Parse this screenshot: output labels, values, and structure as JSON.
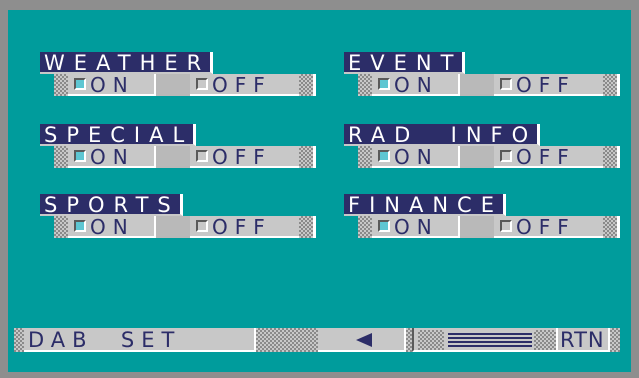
{
  "groups": [
    {
      "title": "WEATHER",
      "on_label": "ON",
      "off_label": "OFF",
      "selected": "on"
    },
    {
      "title": "EVENT",
      "on_label": "ON",
      "off_label": "OFF",
      "selected": "on"
    },
    {
      "title": "SPECIAL",
      "on_label": "ON",
      "off_label": "OFF",
      "selected": "on"
    },
    {
      "title": "RAD  INFO",
      "on_label": "ON",
      "off_label": "OFF",
      "selected": "on"
    },
    {
      "title": "SPORTS",
      "on_label": "ON",
      "off_label": "OFF",
      "selected": "on"
    },
    {
      "title": "FINANCE",
      "on_label": "ON",
      "off_label": "OFF",
      "selected": "on"
    }
  ],
  "bottom_bar": {
    "title": "DAB  SET",
    "back_icon": "left-arrow-icon",
    "slider_icon": "slider-icon",
    "return_label": "RTN"
  },
  "colors": {
    "screen_bg": "#009c9c",
    "title_bg": "#2c2d68",
    "panel": "#c8c8c8",
    "selected_box": "#5ec6d2",
    "frame": "#8e8e8e"
  }
}
